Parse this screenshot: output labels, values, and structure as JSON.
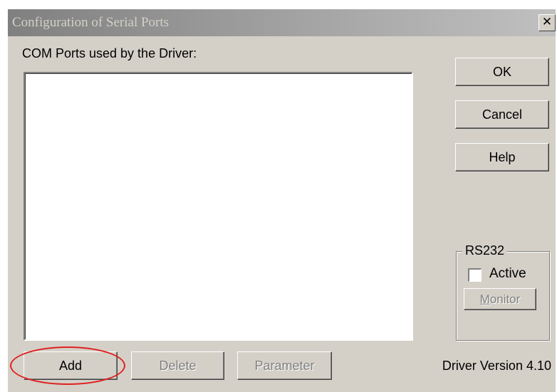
{
  "window": {
    "title": "Configuration of Serial Ports",
    "close_glyph": "✕"
  },
  "ports": {
    "label": "COM Ports used by the Driver:",
    "items": []
  },
  "buttons": {
    "ok": "OK",
    "cancel": "Cancel",
    "help": "Help",
    "add": "Add",
    "delete": "Delete",
    "parameter": "Parameter"
  },
  "rs232": {
    "group_label": "RS232",
    "active_label": "Active",
    "active_checked": false,
    "monitor_label_first": "M",
    "monitor_label_rest": "onitor"
  },
  "footer": {
    "version_text": "Driver Version 4.10"
  },
  "annotation": {
    "highlight_color": "#e02020"
  },
  "colors": {
    "dialog_face": "#d4d0c8",
    "disabled_text": "#808080"
  }
}
